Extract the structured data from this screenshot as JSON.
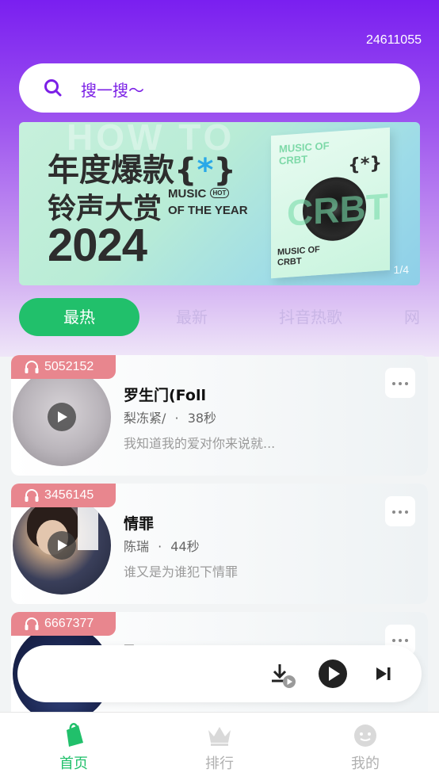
{
  "header": {
    "user_id": "24611055"
  },
  "search": {
    "placeholder": "搜一搜～"
  },
  "banner": {
    "ghost_text": "HOW TO",
    "line1": "年度爆款{",
    "line1_star": "*",
    "line1_end": "}",
    "line2": "铃声大赏",
    "en_line1": "MUSIC",
    "en_hot": "HOT",
    "en_line2": "OF THE YEAR",
    "year": "2024",
    "album_tag_top": "MUSIC OF CRBT",
    "album_brace": "{*}",
    "album_crbt": "CRBT",
    "album_tag_bottom": "MUSIC OF CRBT",
    "indicator": "1/4"
  },
  "tabs": [
    {
      "label": "最热",
      "active": true
    },
    {
      "label": "最新",
      "active": false
    },
    {
      "label": "抖音热歌",
      "active": false
    },
    {
      "label": "网",
      "active": false
    }
  ],
  "songs": [
    {
      "plays": "5052152",
      "title": "罗生门(Foll",
      "artist": "梨冻紧/",
      "dot": "·",
      "duration": "38秒",
      "lyric": "我知道我的爱对你来说就..."
    },
    {
      "plays": "3456145",
      "title": "情罪",
      "artist": "陈瑞",
      "dot": "·",
      "duration": "44秒",
      "lyric": "谁又是为谁犯下情罪"
    },
    {
      "plays": "6667377",
      "title": "飞一",
      "artist": "",
      "dot": "",
      "duration": "",
      "lyric": ""
    }
  ],
  "bottom_nav": [
    {
      "label": "首页",
      "icon": "shopping-bag-icon",
      "active": true
    },
    {
      "label": "排行",
      "icon": "crown-icon",
      "active": false
    },
    {
      "label": "我的",
      "icon": "face-icon",
      "active": false
    }
  ],
  "colors": {
    "accent_purple": "#7a1ff0",
    "accent_green": "#21c06b",
    "badge_pink": "#e8868e"
  }
}
